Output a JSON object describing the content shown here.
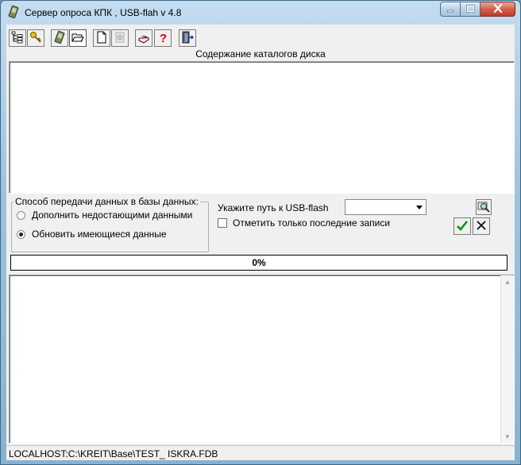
{
  "window": {
    "title": "Сервер опроса  КПК , USB-flah v 4.8"
  },
  "toolbar": {
    "buttons": [
      {
        "icon": "tree-icon"
      },
      {
        "icon": "key-icon"
      },
      {
        "icon": "pda-icon"
      },
      {
        "icon": "open-folder-icon",
        "pressed": true
      },
      {
        "icon": "new-document-icon"
      },
      {
        "icon": "settings-document-icon"
      },
      {
        "icon": "book-icon"
      },
      {
        "icon": "help-icon"
      },
      {
        "icon": "exit-icon"
      }
    ]
  },
  "directory_panel": {
    "title": "Содержание каталогов диска"
  },
  "transfer_mode": {
    "legend": "Способ передачи данных в базы данных:",
    "options": [
      {
        "label": "Дополнить недостающими данными",
        "selected": false
      },
      {
        "label": "Обновить имеющиеся данные",
        "selected": true
      }
    ]
  },
  "usb": {
    "path_label": "Укажите путь к USB-flash",
    "path_value": "",
    "last_records_label": "Отметить только последние записи",
    "last_records_checked": false
  },
  "progress": {
    "text": "0%",
    "value": 0
  },
  "status": {
    "database_path": "LOCALHOST:C:\\KREIT\\Base\\TEST_ ISKRA.FDB"
  }
}
